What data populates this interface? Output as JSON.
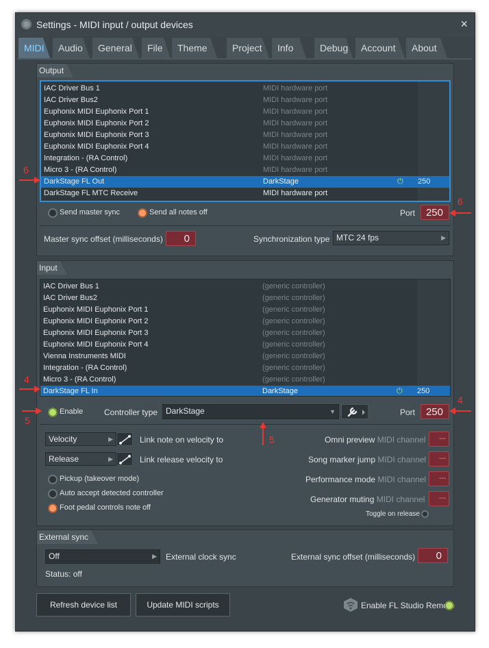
{
  "window": {
    "title": "Settings - MIDI input / output devices",
    "close_label": "×"
  },
  "tabs": [
    "MIDI",
    "Audio",
    "General",
    "File",
    "Theme",
    "Project",
    "Info",
    "Debug",
    "Account",
    "About"
  ],
  "output": {
    "group_label": "Output",
    "devices": [
      {
        "name": "IAC Driver Bus 1",
        "type": "MIDI hardware port"
      },
      {
        "name": "IAC Driver Bus2",
        "type": "MIDI hardware port"
      },
      {
        "name": "Euphonix MIDI Euphonix Port 1",
        "type": "MIDI hardware port"
      },
      {
        "name": "Euphonix MIDI Euphonix Port 2",
        "type": "MIDI hardware port"
      },
      {
        "name": "Euphonix MIDI Euphonix Port 3",
        "type": "MIDI hardware port"
      },
      {
        "name": "Euphonix MIDI Euphonix Port 4",
        "type": "MIDI hardware port"
      },
      {
        "name": "Integration - (RA Control)",
        "type": "MIDI hardware port"
      },
      {
        "name": "Micro 3 - (RA Control)",
        "type": "MIDI hardware port"
      },
      {
        "name": "DarkStage FL Out",
        "type": "DarkStage",
        "port": "250"
      },
      {
        "name": "DarkStage FL MTC Receive",
        "type": "MIDI hardware port"
      }
    ],
    "send_master_sync": "Send master sync",
    "send_all_notes_off": "Send all notes off",
    "port_label": "Port",
    "port_value": "250",
    "master_sync_offset_label": "Master sync offset (milliseconds)",
    "master_sync_offset_value": "0",
    "sync_type_label": "Synchronization type",
    "sync_type_value": "MTC 24 fps"
  },
  "input": {
    "group_label": "Input",
    "devices": [
      {
        "name": "IAC Driver Bus 1",
        "type": "(generic controller)"
      },
      {
        "name": "IAC Driver Bus2",
        "type": "(generic controller)"
      },
      {
        "name": "Euphonix MIDI Euphonix Port 1",
        "type": "(generic controller)"
      },
      {
        "name": "Euphonix MIDI Euphonix Port 2",
        "type": "(generic controller)"
      },
      {
        "name": "Euphonix MIDI Euphonix Port 3",
        "type": "(generic controller)"
      },
      {
        "name": "Euphonix MIDI Euphonix Port 4",
        "type": "(generic controller)"
      },
      {
        "name": "Vienna Instruments MIDI",
        "type": "(generic controller)"
      },
      {
        "name": "Integration - (RA Control)",
        "type": "(generic controller)"
      },
      {
        "name": "Micro 3 - (RA Control)",
        "type": "(generic controller)"
      },
      {
        "name": "DarkStage FL In",
        "type": "DarkStage",
        "port": "250"
      }
    ],
    "enable_label": "Enable",
    "controller_type_label": "Controller type",
    "controller_type_value": "DarkStage",
    "port_label": "Port",
    "port_value": "250",
    "velocity_select": "Velocity",
    "velocity_link_label": "Link note on velocity to",
    "release_select": "Release",
    "release_link_label": "Link release velocity to",
    "pickup_label": "Pickup (takeover mode)",
    "auto_accept_label": "Auto accept detected controller",
    "foot_pedal_label": "Foot pedal controls note off",
    "omni_preview_label": "Omni preview",
    "song_marker_jump_label": "Song marker jump",
    "performance_mode_label": "Performance mode",
    "generator_muting_label": "Generator muting",
    "midi_channel_label": "MIDI channel",
    "channel_value": "---",
    "toggle_on_release_label": "Toggle on release"
  },
  "external_sync": {
    "group_label": "External sync",
    "clock_value": "Off",
    "clock_label": "External clock sync",
    "offset_label": "External sync offset (milliseconds)",
    "offset_value": "0",
    "status": "Status: off"
  },
  "footer": {
    "refresh_button": "Refresh device list",
    "update_button": "Update MIDI scripts",
    "remote_label": "Enable FL Studio Remote"
  },
  "annotations": {
    "output_left": "6",
    "output_right": "6",
    "input_left": "4",
    "input_right": "4",
    "enable": "5",
    "controller": "5"
  },
  "colors": {
    "accent": "#2f8fd6",
    "selection": "#1e6fb9",
    "knob": "#7a2a33",
    "annotation": "#e53935",
    "led_green": "#b7e06a",
    "led_orange": "#ff9a62"
  }
}
